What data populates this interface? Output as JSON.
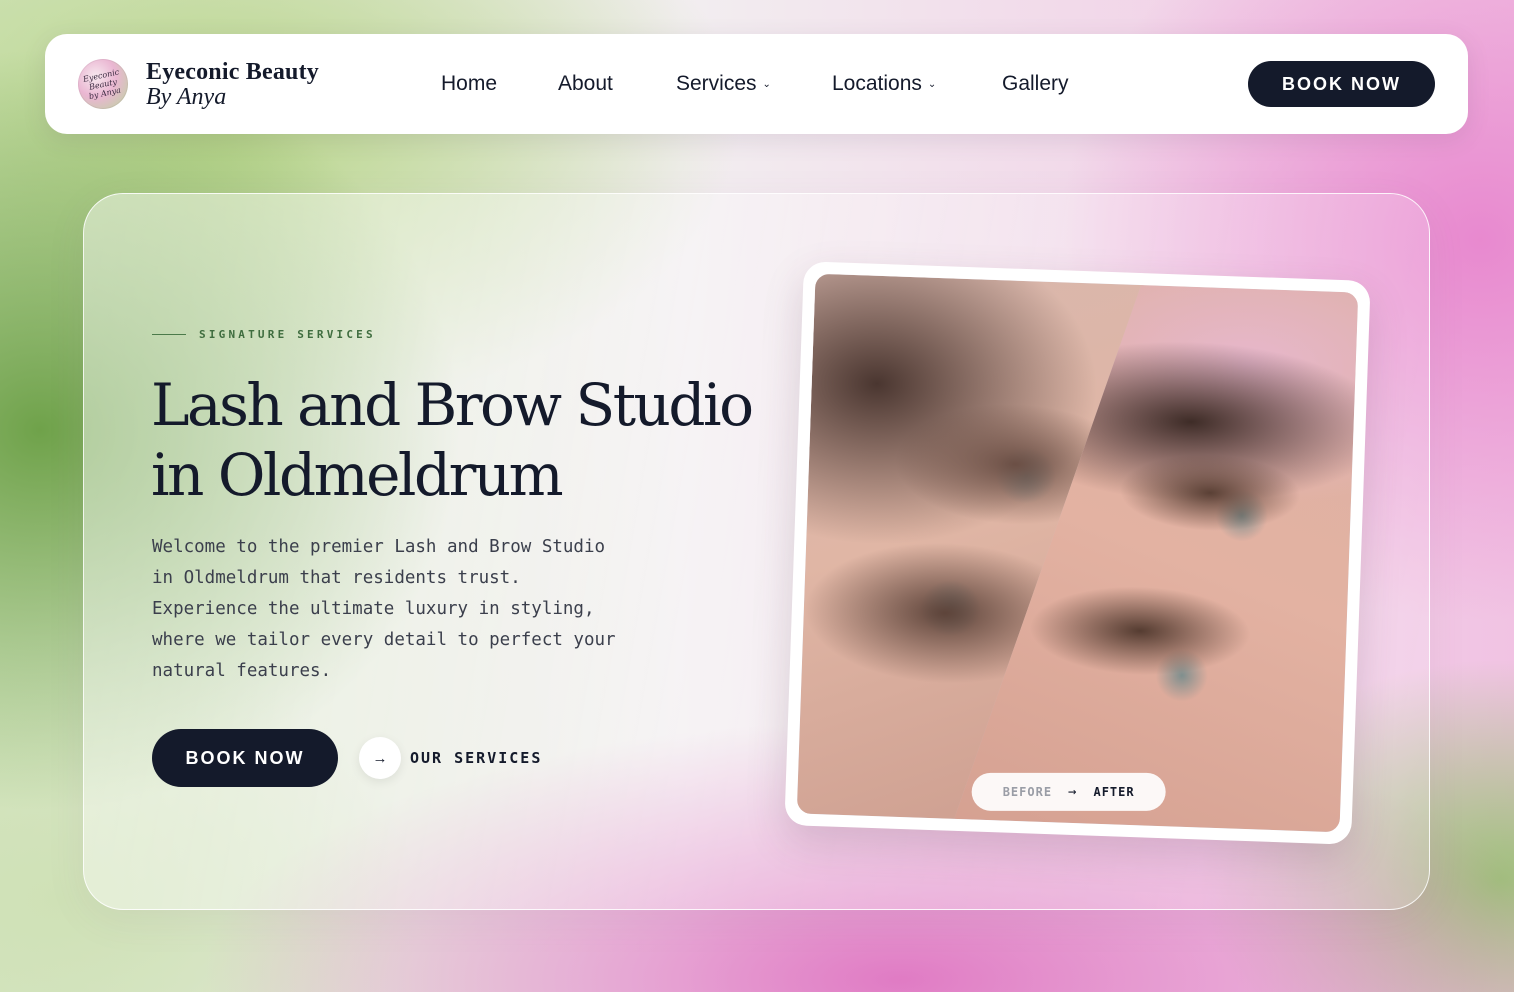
{
  "brand": {
    "logo_text": "Eyeconic Beauty by Anya",
    "name": "Eyeconic Beauty",
    "tagline": "By Anya"
  },
  "nav": {
    "items": [
      {
        "label": "Home"
      },
      {
        "label": "About"
      },
      {
        "label": "Services",
        "has_dropdown": true
      },
      {
        "label": "Locations",
        "has_dropdown": true
      },
      {
        "label": "Gallery"
      }
    ],
    "book_label": "BOOK NOW"
  },
  "hero": {
    "eyebrow": "SIGNATURE SERVICES",
    "title_line1": "Lash and Brow Studio",
    "title_line2": "in Oldmeldrum",
    "description": "Welcome to the premier Lash and Brow Studio in Oldmeldrum that residents trust. Experience the ultimate luxury in styling, where we tailor every detail to perfect your natural features.",
    "book_label": "BOOK NOW",
    "services_label": "OUR SERVICES"
  },
  "comparison": {
    "before_label": "BEFORE",
    "after_label": "AFTER"
  },
  "icons": {
    "dropdown": "chevron-down-icon",
    "arrow": "arrow-right-icon"
  },
  "colors": {
    "primary_dark": "#141a2b",
    "eyebrow_green": "#3f6d3f",
    "background_green": "#6fa24a",
    "background_pink": "#e889cf"
  }
}
